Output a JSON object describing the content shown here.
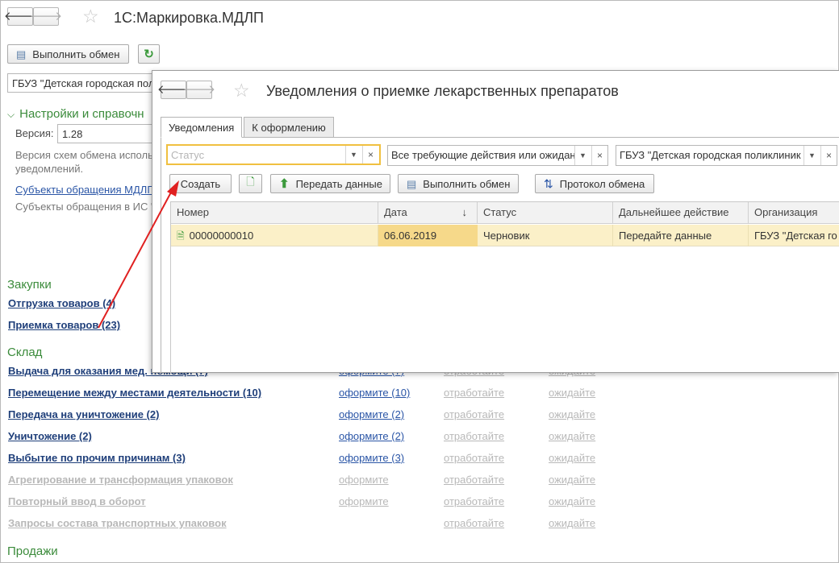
{
  "main": {
    "title": "1С:Маркировка.МДЛП",
    "execute_exchange_label": "Выполнить обмен",
    "organization_value": "ГБУЗ \"Детская городская пол",
    "settings_header": "Настройки и справочн",
    "version_label": "Версия:",
    "version_value": "1.28",
    "version_note_line1": "Версия схем обмена исполь",
    "version_note_line2": "уведомлений.",
    "subjects_link": "Субъекты обращения МДЛП",
    "subjects_note": "Субъекты обращения в ИС \"",
    "sections": {
      "purchases": "Закупки",
      "warehouse": "Склад",
      "sales": "Продажи"
    },
    "purchases_items": [
      {
        "label": "Отгрузка товаров (4)"
      },
      {
        "label": "Приемка товаров (23)"
      }
    ],
    "warehouse_partial_item": {
      "label": "Выдача для оказания мед. помощи (7)",
      "c1": "оформите (7)",
      "c2": "отработайте",
      "c3": "ожидайте"
    },
    "warehouse_items": [
      {
        "label": "Перемещение между местами деятельности (10)",
        "c1": "оформите (10)",
        "c2": "отработайте",
        "c3": "ожидайте"
      },
      {
        "label": "Передача на уничтожение (2)",
        "c1": "оформите (2)",
        "c2": "отработайте",
        "c3": "ожидайте"
      },
      {
        "label": "Уничтожение (2)",
        "c1": "оформите (2)",
        "c2": "отработайте",
        "c3": "ожидайте"
      },
      {
        "label": "Выбытие по прочим причинам (3)",
        "c1": "оформите (3)",
        "c2": "отработайте",
        "c3": "ожидайте"
      }
    ],
    "warehouse_disabled_items": [
      {
        "label": "Агрегирование и трансформация упаковок",
        "c1": "оформите",
        "c2": "отработайте",
        "c3": "ожидайте"
      },
      {
        "label": "Повторный ввод в оборот",
        "c1": "оформите",
        "c2": "отработайте",
        "c3": "ожидайте"
      },
      {
        "label": "Запросы состава транспортных упаковок",
        "c1": "",
        "c2": "отработайте",
        "c3": "ожидайте"
      }
    ]
  },
  "dialog": {
    "title": "Уведомления о приемке лекарственных препаратов",
    "tabs": [
      "Уведомления",
      "К оформлению"
    ],
    "filters": {
      "status_placeholder": "Статус",
      "actions_value": "Все требующие действия или ожидан",
      "org_value": "ГБУЗ \"Детская городская поликлиник"
    },
    "toolbar": {
      "create": "Создать",
      "send_data": "Передать данные",
      "execute_exchange": "Выполнить обмен",
      "exchange_log": "Протокол обмена"
    },
    "columns": [
      "Номер",
      "Дата",
      "Статус",
      "Дальнейшее действие",
      "Организация"
    ],
    "sort_indicator": "↓",
    "rows": [
      {
        "number": "00000000010",
        "date": "06.06.2019",
        "status": "Черновик",
        "next_action": "Передайте данные",
        "organization": "ГБУЗ \"Детская го"
      }
    ]
  },
  "colors": {
    "section_green": "#3b8b3b",
    "link_blue": "#2a55a6",
    "selected_row": "#fbf0c8",
    "focus_border": "#f0c040",
    "annotation_arrow": "#e02020"
  },
  "icons": [
    "back-arrow-icon",
    "forward-arrow-icon",
    "favorite-star-icon",
    "refresh-icon",
    "exchange-icon",
    "new-document-icon",
    "upload-green-arrow-icon",
    "exchange-log-icon",
    "document-row-icon"
  ]
}
